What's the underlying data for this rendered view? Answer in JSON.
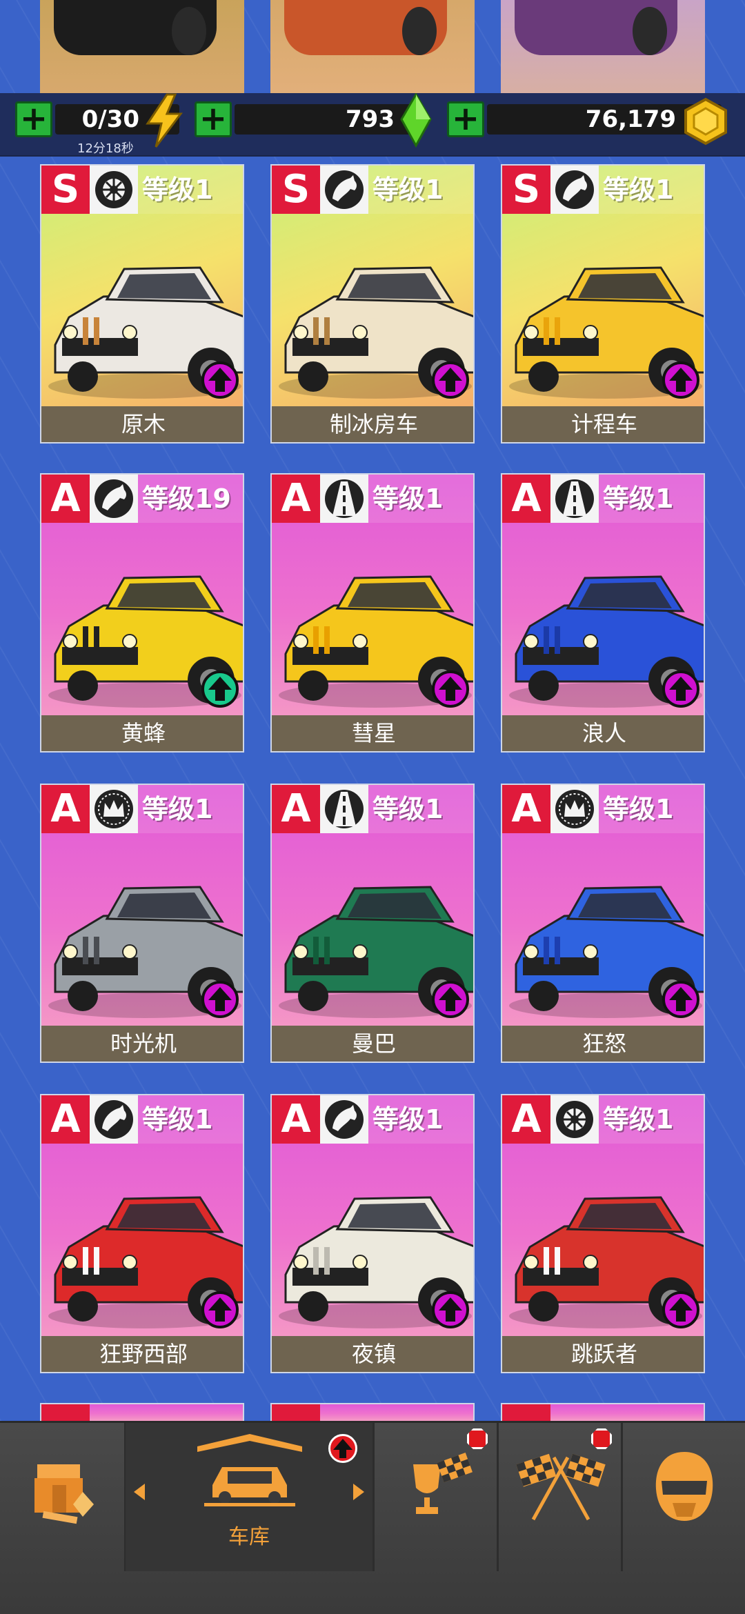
{
  "resources": {
    "energy": {
      "value": "0/30",
      "timer": "12分18秒",
      "icon": "lightning-icon"
    },
    "gems": {
      "value": "793",
      "icon": "green-gem-icon"
    },
    "coins": {
      "value": "76,179",
      "icon": "gold-coin-icon"
    }
  },
  "cards": [
    {
      "class": "S",
      "type_icon": "tire-icon",
      "level": "等级1",
      "name": "原木",
      "upgrade": "magenta"
    },
    {
      "class": "S",
      "type_icon": "horse-icon",
      "level": "等级1",
      "name": "制冰房车",
      "upgrade": "magenta"
    },
    {
      "class": "S",
      "type_icon": "horse-icon",
      "level": "等级1",
      "name": "计程车",
      "upgrade": "magenta"
    },
    {
      "class": "A",
      "type_icon": "horse-icon",
      "level": "等级19",
      "name": "黄蜂",
      "upgrade": "green"
    },
    {
      "class": "A",
      "type_icon": "road-icon",
      "level": "等级1",
      "name": "彗星",
      "upgrade": "magenta"
    },
    {
      "class": "A",
      "type_icon": "road-icon",
      "level": "等级1",
      "name": "浪人",
      "upgrade": "magenta"
    },
    {
      "class": "A",
      "type_icon": "crown-gauge-icon",
      "level": "等级1",
      "name": "时光机",
      "upgrade": "magenta"
    },
    {
      "class": "A",
      "type_icon": "road-icon",
      "level": "等级1",
      "name": "曼巴",
      "upgrade": "magenta"
    },
    {
      "class": "A",
      "type_icon": "crown-gauge-icon",
      "level": "等级1",
      "name": "狂怒",
      "upgrade": "magenta"
    },
    {
      "class": "A",
      "type_icon": "horse-icon",
      "level": "等级1",
      "name": "狂野西部",
      "upgrade": "magenta"
    },
    {
      "class": "A",
      "type_icon": "horse-icon",
      "level": "等级1",
      "name": "夜镇",
      "upgrade": "magenta"
    },
    {
      "class": "A",
      "type_icon": "tire-icon",
      "level": "等级1",
      "name": "跳跃者",
      "upgrade": "magenta"
    }
  ],
  "nav": {
    "garage_label": "车库",
    "items": [
      "shop-icon",
      "garage-icon",
      "trophy-flags-icon",
      "checkered-flags-icon",
      "helmet-icon"
    ]
  },
  "colors": {
    "background": "#3a63c9",
    "class_badge": "#e01a3b",
    "upgrade_magenta": "#cf10cf",
    "upgrade_green": "#19c98c",
    "nav_accent": "#f3a13a",
    "name_bar": "#6f6450"
  }
}
